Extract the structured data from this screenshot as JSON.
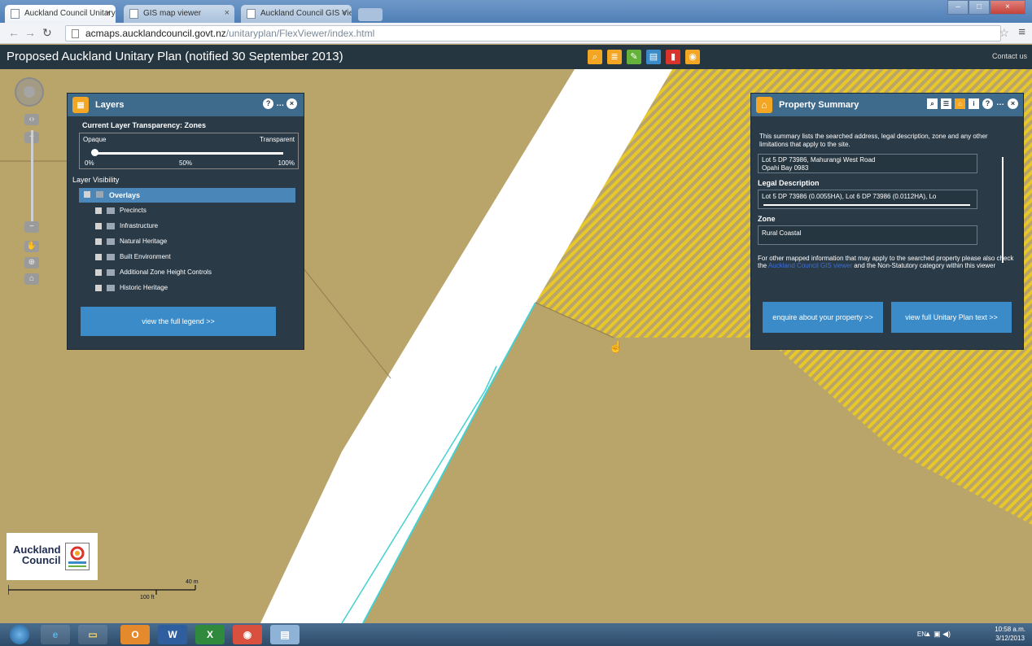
{
  "browser": {
    "tabs": [
      {
        "label": "Auckland Council Unitary",
        "active": true
      },
      {
        "label": "GIS map viewer",
        "active": false
      },
      {
        "label": "Auckland Council GIS Vie",
        "active": false
      }
    ],
    "url": {
      "host": "acmaps.aucklandcouncil.govt.nz",
      "path": "/unitaryplan/FlexViewer/index.html"
    }
  },
  "app": {
    "title": "Proposed Auckland Unitary Plan (notified 30 September 2013)",
    "contact_label": "Contact us",
    "toolbar_icons": [
      {
        "name": "search-icon",
        "color": "#f3a524"
      },
      {
        "name": "layers-icon",
        "color": "#f3a524"
      },
      {
        "name": "draw-icon",
        "color": "#65b23a"
      },
      {
        "name": "print-icon",
        "color": "#3a8bc8"
      },
      {
        "name": "bookmark-icon",
        "color": "#d8342b"
      },
      {
        "name": "location-icon",
        "color": "#f3a524"
      }
    ]
  },
  "layers_panel": {
    "title": "Layers",
    "transparency_title": "Current Layer Transparency: Zones",
    "opaque_label": "Opaque",
    "transparent_label": "Transparent",
    "tick_0": "0%",
    "tick_50": "50%",
    "tick_100": "100%",
    "visibility_label": "Layer Visibility",
    "overlays_label": "Overlays",
    "layers": [
      {
        "label": "Precincts"
      },
      {
        "label": "Infrastructure"
      },
      {
        "label": "Natural Heritage"
      },
      {
        "label": "Built Environment"
      },
      {
        "label": "Additional Zone Height Controls"
      },
      {
        "label": "Historic Heritage"
      }
    ],
    "legend_button": "view the full legend >>"
  },
  "property_summary": {
    "title": "Property Summary",
    "intro": "This summary lists the searched address, legal description, zone and any other limitations that apply to the site.",
    "address_line1": "Lot 5 DP 73986, Mahurangi West Road",
    "address_line2": "Opahi Bay  0983",
    "legal_label": "Legal Description",
    "legal_value": "Lot 5 DP 73986 (0.0055HA), Lot 6 DP 73986 (0.0112HA), Lo",
    "zone_label": "Zone",
    "zone_value": "Rural Coastal",
    "other_pre": "For other mapped information that may apply to the searched property please also check the",
    "other_link": "Auckland Council GIS viewer",
    "other_post": "and the Non-Statutory category within this viewer",
    "enquire_button": "enquire about your property >>",
    "fulltext_button": "view full Unitary Plan text >>"
  },
  "logo": {
    "line1": "Auckland",
    "line2": "Council"
  },
  "scale": {
    "metres": "40 m",
    "feet": "100 ft"
  },
  "taskbar": {
    "apps": [
      "ie",
      "explorer",
      "outlook",
      "word",
      "excel",
      "chrome",
      "notepad"
    ],
    "lang": "EN",
    "time": "10:58 a.m.",
    "date": "3/12/2013"
  }
}
